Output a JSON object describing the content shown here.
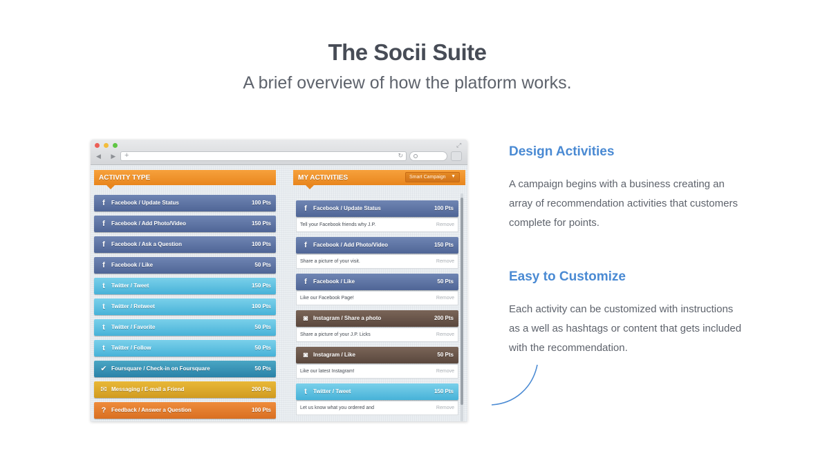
{
  "hero": {
    "title": "The Socii Suite",
    "subtitle": "A brief overview of how the platform works."
  },
  "features": [
    {
      "title": "Design Activities",
      "body": "A campaign begins with a business creating an array of recommendation activities that customers complete for points."
    },
    {
      "title": "Easy to Customize",
      "body": "Each activity can be customized with instructions as a well as hashtags or content that gets included with the recommendation."
    }
  ],
  "browser": {
    "nav_arrows": "◀ ▶",
    "new_tab_icon": "+",
    "reload_icon": "↻",
    "expand_icon": "⤢"
  },
  "activity_panel": {
    "heading": "ACTIVITY TYPE",
    "items": [
      {
        "icon": "f",
        "name": "Facebook / Update Status",
        "points": "100 Pts",
        "kind": "facebook"
      },
      {
        "icon": "f",
        "name": "Facebook / Add Photo/Video",
        "points": "150 Pts",
        "kind": "facebook"
      },
      {
        "icon": "f",
        "name": "Facebook / Ask a Question",
        "points": "100 Pts",
        "kind": "facebook"
      },
      {
        "icon": "f",
        "name": "Facebook / Like",
        "points": "50 Pts",
        "kind": "facebook"
      },
      {
        "icon": "t",
        "name": "Twitter / Tweet",
        "points": "150 Pts",
        "kind": "twitter"
      },
      {
        "icon": "t",
        "name": "Twitter / Retweet",
        "points": "100 Pts",
        "kind": "twitter"
      },
      {
        "icon": "t",
        "name": "Twitter / Favorite",
        "points": "50 Pts",
        "kind": "twitter"
      },
      {
        "icon": "t",
        "name": "Twitter / Follow",
        "points": "50 Pts",
        "kind": "twitter"
      },
      {
        "icon": "✔",
        "name": "Foursquare / Check-in on Foursquare",
        "points": "50 Pts",
        "kind": "foursquare"
      },
      {
        "icon": "✉",
        "name": "Messaging / E-mail a Friend",
        "points": "200 Pts",
        "kind": "messaging"
      },
      {
        "icon": "?",
        "name": "Feedback / Answer a Question",
        "points": "100 Pts",
        "kind": "feedback"
      }
    ]
  },
  "my_activities": {
    "heading": "MY ACTIVITIES",
    "campaign_select": "Smart Campaign",
    "caret": "▼",
    "items": [
      {
        "icon": "f",
        "name": "Facebook / Update Status",
        "points": "100 Pts",
        "kind": "facebook",
        "instruction": "Tell your Facebook friends why J.P.",
        "remove": "Remove"
      },
      {
        "icon": "f",
        "name": "Facebook / Add Photo/Video",
        "points": "150 Pts",
        "kind": "facebook",
        "instruction": "Share a picture of your visit.",
        "remove": "Remove"
      },
      {
        "icon": "f",
        "name": "Facebook / Like",
        "points": "50 Pts",
        "kind": "facebook",
        "instruction": "Like our Facebook Page!",
        "remove": "Remove"
      },
      {
        "icon": "◙",
        "name": "Instagram / Share a photo",
        "points": "200 Pts",
        "kind": "instagram",
        "instruction": "Share a picture of your J.P. Licks",
        "remove": "Remove"
      },
      {
        "icon": "◙",
        "name": "Instagram / Like",
        "points": "50 Pts",
        "kind": "instagram",
        "instruction": "Like our latest Instagram!",
        "remove": "Remove"
      },
      {
        "icon": "t",
        "name": "Twitter / Tweet",
        "points": "150 Pts",
        "kind": "twitter",
        "instruction": "Let us know what you ordered and",
        "remove": "Remove"
      }
    ]
  },
  "colors": {
    "accent_blue": "#4a8ad3",
    "panel_orange": "#f7a13c",
    "facebook": "#5a70a2",
    "twitter": "#5ec0e0",
    "foursquare": "#3a94b6",
    "messaging": "#e0ac2c",
    "feedback": "#e57d2e",
    "instagram": "#6a564a"
  }
}
